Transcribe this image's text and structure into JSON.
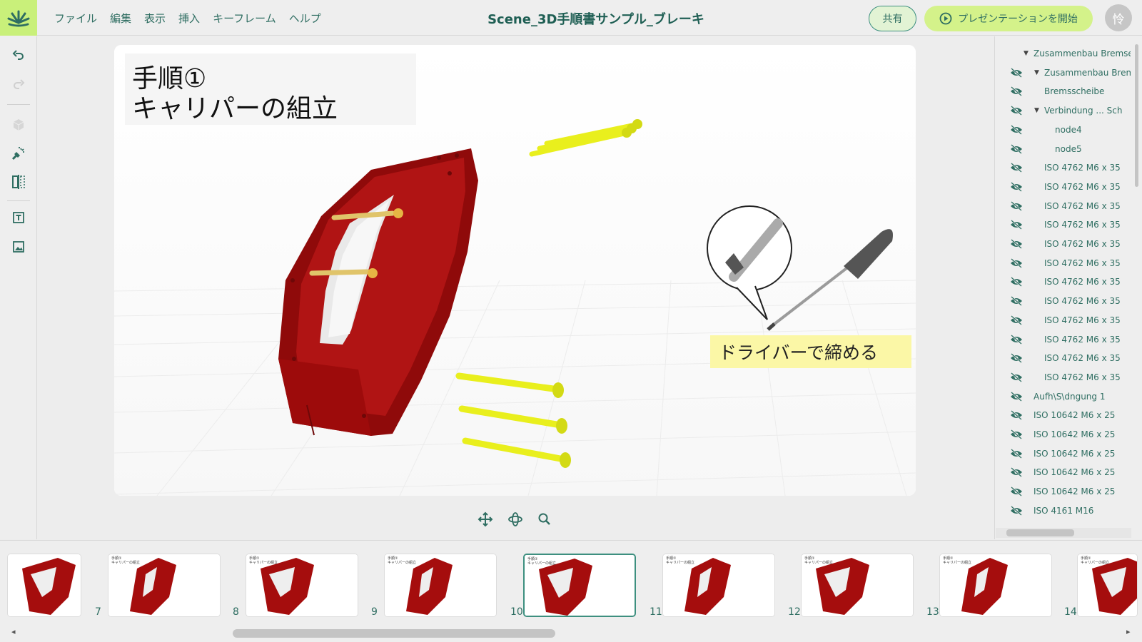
{
  "app": {
    "logo": "burst-logo"
  },
  "menu": [
    {
      "label": "ファイル"
    },
    {
      "label": "編集"
    },
    {
      "label": "表示"
    },
    {
      "label": "挿入"
    },
    {
      "label": "キーフレーム"
    },
    {
      "label": "ヘルプ"
    }
  ],
  "document": {
    "title": "Scene_3D手順書サンプル_ブレーキ"
  },
  "header": {
    "share_label": "共有",
    "present_label": "プレゼンテーションを開始",
    "avatar_initial": "怜"
  },
  "toolbar": {
    "tools": [
      "undo-icon",
      "redo-icon",
      "cube-icon",
      "explode-icon",
      "split-view-icon",
      "text-box-icon",
      "image-icon"
    ]
  },
  "canvas": {
    "step_title_line1": "手順①",
    "step_title_line2": "キャリパーの組立",
    "callout_text": "ドライバーで締める"
  },
  "view_controls": [
    "pan-icon",
    "orbit-icon",
    "zoom-icon"
  ],
  "tree": {
    "items": [
      {
        "label": "Zusammenbau Bremse",
        "caret": "▼",
        "eye": false
      },
      {
        "label": "Zusammenbau Brem",
        "caret": "▼",
        "eye": true
      },
      {
        "label": "Bremsscheibe",
        "caret": "",
        "eye": true
      },
      {
        "label": "Verbindung ... Sch",
        "caret": "▼",
        "eye": true
      },
      {
        "label": "node4",
        "caret": "",
        "eye": true
      },
      {
        "label": "node5",
        "caret": "",
        "eye": true
      },
      {
        "label": "ISO 4762 M6 x 35",
        "caret": "",
        "eye": true
      },
      {
        "label": "ISO 4762 M6 x 35",
        "caret": "",
        "eye": true
      },
      {
        "label": "ISO 4762 M6 x 35",
        "caret": "",
        "eye": true
      },
      {
        "label": "ISO 4762 M6 x 35",
        "caret": "",
        "eye": true
      },
      {
        "label": "ISO 4762 M6 x 35",
        "caret": "",
        "eye": true
      },
      {
        "label": "ISO 4762 M6 x 35",
        "caret": "",
        "eye": true
      },
      {
        "label": "ISO 4762 M6 x 35",
        "caret": "",
        "eye": true
      },
      {
        "label": "ISO 4762 M6 x 35",
        "caret": "",
        "eye": true
      },
      {
        "label": "ISO 4762 M6 x 35",
        "caret": "",
        "eye": true
      },
      {
        "label": "ISO 4762 M6 x 35",
        "caret": "",
        "eye": true
      },
      {
        "label": "ISO 4762 M6 x 35",
        "caret": "",
        "eye": true
      },
      {
        "label": "ISO 4762 M6 x 35",
        "caret": "",
        "eye": true
      },
      {
        "label": "Aufh\\S\\dngung 1",
        "caret": "",
        "eye": true
      },
      {
        "label": "ISO 10642 M6 x 25",
        "caret": "",
        "eye": true
      },
      {
        "label": "ISO 10642 M6 x 25",
        "caret": "",
        "eye": true
      },
      {
        "label": "ISO 10642 M6 x 25",
        "caret": "",
        "eye": true
      },
      {
        "label": "ISO 10642 M6 x 25",
        "caret": "",
        "eye": true
      },
      {
        "label": "ISO 10642 M6 x 25",
        "caret": "",
        "eye": true
      },
      {
        "label": "ISO 4161 M16",
        "caret": "",
        "eye": true
      }
    ]
  },
  "filmstrip": {
    "thumbs": [
      {
        "number": "",
        "active": false,
        "mini_text": ""
      },
      {
        "number": "7",
        "active": false,
        "mini_text": "手順①\nキャリパーの組立"
      },
      {
        "number": "8",
        "active": false,
        "mini_text": "手順①\nキャリパーの組立"
      },
      {
        "number": "9",
        "active": false,
        "mini_text": "手順①\nキャリパーの組立"
      },
      {
        "number": "10",
        "active": true,
        "mini_text": "手順①\nキャリパーの組立"
      },
      {
        "number": "11",
        "active": false,
        "mini_text": "手順①\nキャリパーの組立"
      },
      {
        "number": "12",
        "active": false,
        "mini_text": "手順①\nキャリパーの組立"
      },
      {
        "number": "13",
        "active": false,
        "mini_text": "手順①\nキャリパーの組立"
      },
      {
        "number": "14",
        "active": false,
        "mini_text": "手順①\nキャリパーの組立"
      }
    ]
  },
  "colors": {
    "accent": "#2f6e62",
    "brand_green": "#d4f28a",
    "caliper_red": "#9e0b0b",
    "bolt_yellow": "#e6ef1c",
    "callout_bg": "#fbf7a6"
  }
}
